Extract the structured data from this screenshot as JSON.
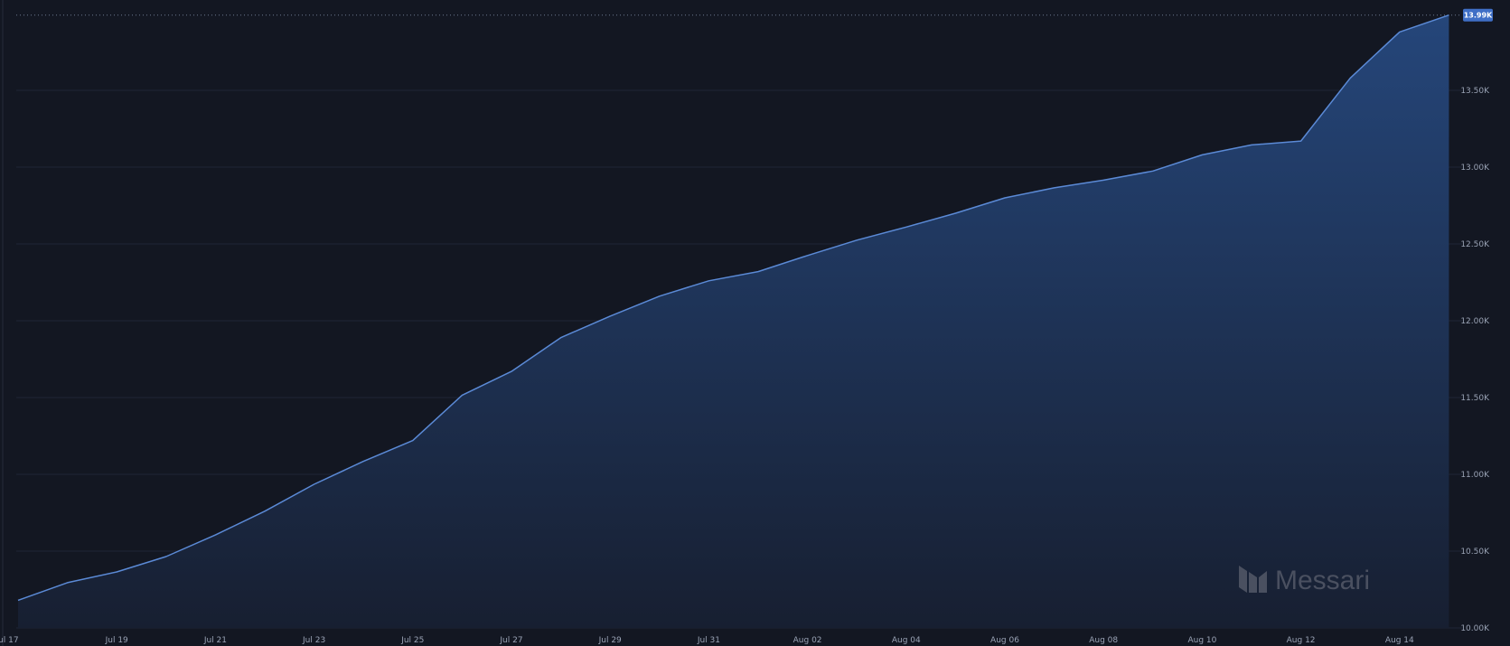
{
  "chart_data": {
    "type": "area",
    "x": [
      "Jul 17",
      "Jul 18",
      "Jul 19",
      "Jul 20",
      "Jul 21",
      "Jul 22",
      "Jul 23",
      "Jul 24",
      "Jul 25",
      "Jul 26",
      "Jul 27",
      "Jul 28",
      "Jul 29",
      "Jul 30",
      "Jul 31",
      "Aug 01",
      "Aug 02",
      "Aug 03",
      "Aug 04",
      "Aug 05",
      "Aug 06",
      "Aug 07",
      "Aug 08",
      "Aug 09",
      "Aug 10",
      "Aug 11",
      "Aug 12",
      "Aug 13",
      "Aug 14",
      "Aug 15"
    ],
    "values": [
      10180,
      10295,
      10365,
      10465,
      10605,
      10760,
      10935,
      11085,
      11220,
      11515,
      11670,
      11890,
      12030,
      12160,
      12260,
      12320,
      12425,
      12525,
      12610,
      12700,
      12800,
      12865,
      12915,
      12975,
      13080,
      13145,
      13170,
      13580,
      13880,
      13990
    ],
    "x_ticks": [
      "Jul 17",
      "Jul 19",
      "Jul 21",
      "Jul 23",
      "Jul 25",
      "Jul 27",
      "Jul 29",
      "Jul 31",
      "Aug 02",
      "Aug 04",
      "Aug 06",
      "Aug 08",
      "Aug 10",
      "Aug 12",
      "Aug 14"
    ],
    "y_ticks": [
      {
        "value": 10000,
        "label": "10.00K"
      },
      {
        "value": 10500,
        "label": "10.50K"
      },
      {
        "value": 11000,
        "label": "11.00K"
      },
      {
        "value": 11500,
        "label": "11.50K"
      },
      {
        "value": 12000,
        "label": "12.00K"
      },
      {
        "value": 12500,
        "label": "12.50K"
      },
      {
        "value": 13000,
        "label": "13.00K"
      },
      {
        "value": 13500,
        "label": "13.50K"
      }
    ],
    "ylim": [
      10000,
      14000
    ],
    "last_value_label": "13.99K",
    "grid": true,
    "colors": {
      "background": "#131722",
      "line": "#5b8ad6",
      "fill_top": "#25467a",
      "fill_bottom": "#171f31",
      "grid": "#1f2636",
      "tick_text": "#9aa3b5",
      "badge": "#3f6fc6"
    }
  },
  "watermark": {
    "text": "Messari",
    "icon": "messari-logo-icon"
  }
}
